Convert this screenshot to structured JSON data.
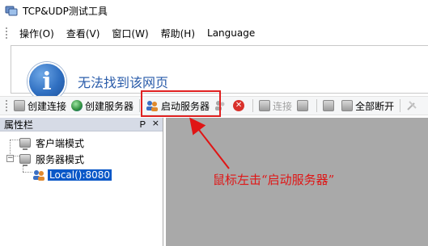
{
  "window": {
    "title": "TCP&UDP测试工具"
  },
  "menu": [
    "操作(O)",
    "查看(V)",
    "窗口(W)",
    "帮助(H)",
    "Language"
  ],
  "browser": {
    "message": "无法找到该网页"
  },
  "toolbar": {
    "create_connection": "创建连接",
    "create_server": "创建服务器",
    "start_server": "启动服务器",
    "connect": "连接",
    "disconnect_all": "全部断开"
  },
  "properties": {
    "title": "属性栏",
    "pin": "Ｐ",
    "close": "×",
    "tree": [
      {
        "label": "客户端模式"
      },
      {
        "label": "服务器模式",
        "expander": "−"
      },
      {
        "label": "Local():8080"
      }
    ]
  },
  "annotation": {
    "text": "鼠标左击“启动服务器”"
  },
  "colors": {
    "highlight": "#e02020",
    "annotation": "#e01515",
    "selection": "#0a58c8"
  }
}
